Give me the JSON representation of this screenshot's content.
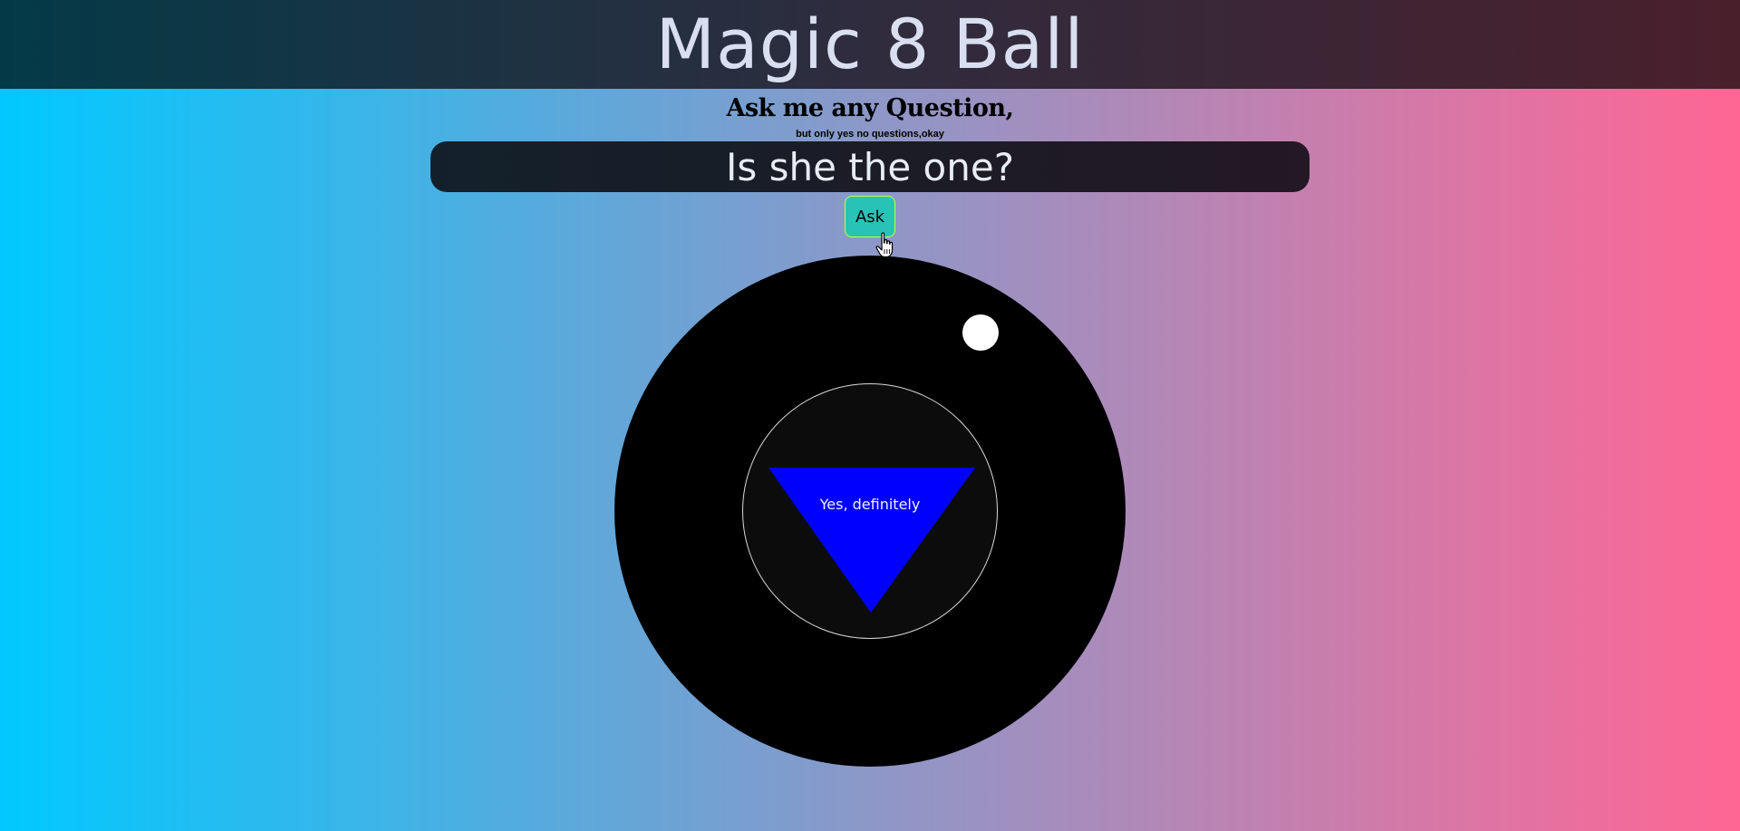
{
  "header": {
    "title": "Magic 8 Ball"
  },
  "prompt": {
    "heading": "Ask me any Question,",
    "note": "but only yes no questions,okay"
  },
  "question_input": {
    "value": "Is she the one?"
  },
  "ask_button": {
    "label": "Ask"
  },
  "ball": {
    "answer": "Yes, definitely",
    "triangle_color": "#0000ff",
    "ball_color": "#000000"
  },
  "icons": {
    "cursor": "hand-pointer-icon"
  },
  "colors": {
    "button_bg": "#27c3b7",
    "button_border": "#c9ff3a",
    "gradient_left": "#00c9ff",
    "gradient_right": "#ff6694"
  }
}
